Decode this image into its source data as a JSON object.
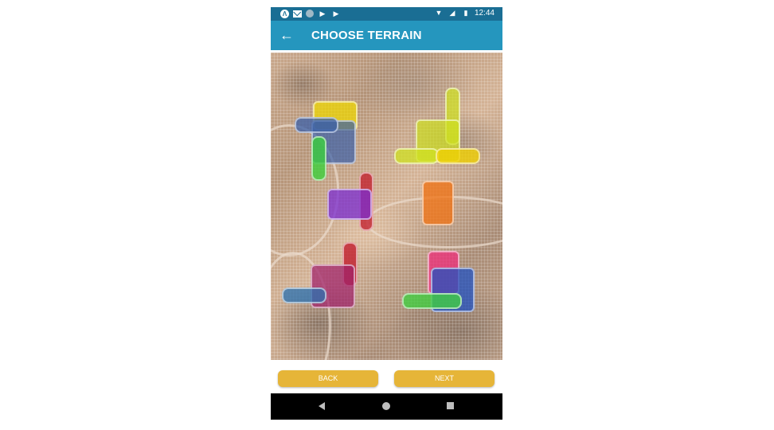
{
  "status_bar": {
    "time": "12:44",
    "notification_icons": [
      "a-circle-icon",
      "mail-icon",
      "circle-icon",
      "play-store-icon",
      "play-store-icon"
    ],
    "system_icons": [
      "wifi-icon",
      "signal-icon",
      "battery-icon"
    ]
  },
  "app_bar": {
    "title": "CHOOSE TERRAIN",
    "back_icon": "arrow-left-icon"
  },
  "terrain_shapes": [
    {
      "name": "yellow-block",
      "color": "#f0d800"
    },
    {
      "name": "blue-bar-top-left",
      "color": "#3a5fa8"
    },
    {
      "name": "blue-block-top-left",
      "color": "#3a5fa8"
    },
    {
      "name": "green-bar-left",
      "color": "#3ad13a"
    },
    {
      "name": "red-bar-center",
      "color": "#c01a2a"
    },
    {
      "name": "purple-block",
      "color": "#7a2bd0"
    },
    {
      "name": "yellow-green-vertical-bar",
      "color": "#cfe020"
    },
    {
      "name": "yellow-green-block",
      "color": "#cfe020"
    },
    {
      "name": "yellow-green-horizontal-bar",
      "color": "#cfe020"
    },
    {
      "name": "yellow-horizontal-bar",
      "color": "#f0d000"
    },
    {
      "name": "orange-block",
      "color": "#f07010"
    },
    {
      "name": "red-bar-lower-left",
      "color": "#c01a2a"
    },
    {
      "name": "magenta-block",
      "color": "#a0206a"
    },
    {
      "name": "blue-bar-lower-left",
      "color": "#2a70b0"
    },
    {
      "name": "pink-block",
      "color": "#f02878"
    },
    {
      "name": "blue-block-lower-right",
      "color": "#2050c0"
    },
    {
      "name": "green-bar-lower-right",
      "color": "#40d040"
    }
  ],
  "buttons": {
    "back_label": "BACK",
    "next_label": "NEXT",
    "color": "#e6b538"
  },
  "nav_bar": {
    "icons": [
      "nav-back-icon",
      "nav-home-icon",
      "nav-recents-icon"
    ]
  }
}
